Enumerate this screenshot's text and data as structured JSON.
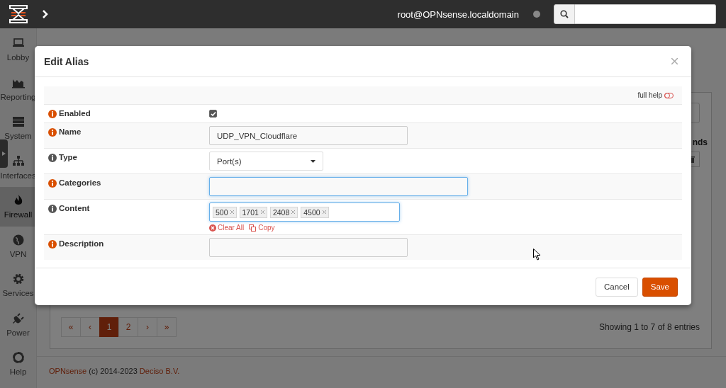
{
  "topbar": {
    "user": "root@OPNsense.localdomain"
  },
  "sidebar": {
    "items": [
      {
        "label": "Lobby",
        "selected": false
      },
      {
        "label": "Reporting",
        "selected": false
      },
      {
        "label": "System",
        "selected": false
      },
      {
        "label": "Interfaces",
        "selected": false
      },
      {
        "label": "Firewall",
        "selected": true
      },
      {
        "label": "VPN",
        "selected": false
      },
      {
        "label": "Services",
        "selected": false
      },
      {
        "label": "Power",
        "selected": false
      },
      {
        "label": "Help",
        "selected": false
      }
    ]
  },
  "table": {
    "column_fragment": "nds"
  },
  "pagination": [
    {
      "label": "«",
      "selected": false
    },
    {
      "label": "‹",
      "selected": false
    },
    {
      "label": "1",
      "selected": true
    },
    {
      "label": "2",
      "selected": false
    },
    {
      "label": "›",
      "selected": false
    },
    {
      "label": "»",
      "selected": false
    }
  ],
  "entries_info": "Showing 1 to 7 of 8 entries",
  "footer": {
    "brand": "OPNsense",
    "text": "(c) 2014-2023",
    "company": "Deciso B.V."
  },
  "dialog": {
    "title": "Edit Alias",
    "help_toggle": "full help",
    "fields": [
      {
        "kind": "checkbox",
        "label": "Enabled",
        "color": "#d94f00",
        "checked": true
      },
      {
        "kind": "text",
        "label": "Name",
        "color": "#d94f00",
        "value": "UDP_VPN_Cloudflare",
        "focused": false,
        "wide": false
      },
      {
        "kind": "select",
        "label": "Type",
        "color": "#555555",
        "value": "Port(s)"
      },
      {
        "kind": "text",
        "label": "Categories",
        "color": "#d94f00",
        "focused": true,
        "wide": true
      },
      {
        "kind": "tags",
        "label": "Content",
        "color": "#555555",
        "focused": true,
        "tags": [
          "500",
          "1701",
          "2408",
          "4500"
        ],
        "actions": [
          "Clear All",
          "Copy"
        ]
      },
      {
        "kind": "text",
        "label": "Description",
        "color": "#d94f00",
        "focused": false,
        "wide": false
      }
    ],
    "buttons": [
      {
        "label": "Cancel",
        "kind": "default"
      },
      {
        "label": "Save",
        "kind": "primary"
      }
    ]
  }
}
